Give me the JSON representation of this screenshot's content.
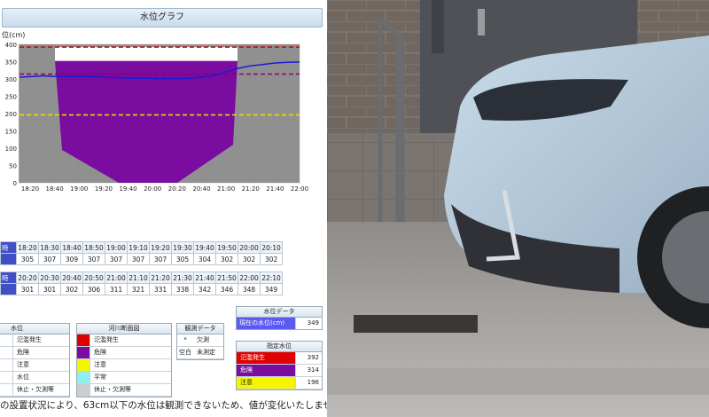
{
  "panel": {
    "title": "水位グラフ"
  },
  "chart_data": {
    "type": "area",
    "ylabel": "位(cm)",
    "ylim": [
      0,
      400
    ],
    "yticks": [
      "400",
      "350",
      "300",
      "250",
      "200",
      "150",
      "100",
      "50",
      "0"
    ],
    "xticks": [
      "18:20",
      "18:40",
      "19:00",
      "19:20",
      "19:40",
      "20:00",
      "20:20",
      "20:40",
      "21:00",
      "21:20",
      "21:40",
      "22:00"
    ],
    "lines": {
      "flood": 392,
      "danger": 314,
      "caution": 196
    },
    "water_level": [
      305,
      307,
      309,
      307,
      307,
      307,
      307,
      305,
      304,
      302,
      302,
      302,
      301,
      301,
      302,
      306,
      311,
      321,
      331,
      338,
      342,
      346,
      348,
      349
    ],
    "bank_profile_section": "river cross-section",
    "colors": {
      "ground": "#8a8a8a",
      "section": "#7a0ca0",
      "line": "#1a1ad8",
      "flood": "#e00000",
      "danger": "#8b0070",
      "caution": "#f0e000"
    }
  },
  "table1": {
    "head": "時",
    "times": [
      "18:20",
      "18:30",
      "18:40",
      "18:50",
      "19:00",
      "19:10",
      "19:20",
      "19:30",
      "19:40",
      "19:50",
      "20:00",
      "20:10"
    ],
    "values": [
      "305",
      "307",
      "309",
      "307",
      "307",
      "307",
      "307",
      "305",
      "304",
      "302",
      "302",
      "302"
    ]
  },
  "table2": {
    "head": "時",
    "times": [
      "20:20",
      "20:30",
      "20:40",
      "20:50",
      "21:00",
      "21:10",
      "21:20",
      "21:30",
      "21:40",
      "21:50",
      "22:00",
      "22:10"
    ],
    "values": [
      "301",
      "301",
      "302",
      "306",
      "311",
      "321",
      "331",
      "338",
      "342",
      "346",
      "348",
      "349"
    ]
  },
  "legend_level": {
    "title": "水位",
    "items": [
      {
        "label": "氾濫発生"
      },
      {
        "label": "危険"
      },
      {
        "label": "注意"
      },
      {
        "label": "水位"
      },
      {
        "label": "休止・欠測等"
      }
    ]
  },
  "legend_section": {
    "title": "河川断面図",
    "items": [
      {
        "label": "氾濫発生",
        "color": "#e00000"
      },
      {
        "label": "危険",
        "color": "#7a0ca0"
      },
      {
        "label": "注意",
        "color": "#f5f500"
      },
      {
        "label": "平常",
        "color": "#8ef0f0"
      },
      {
        "label": "休止・欠測等",
        "color": "#cccccc"
      }
    ]
  },
  "observation": {
    "title": "観測データ",
    "rows": [
      {
        "mark": "*",
        "text": "欠測"
      },
      {
        "mark": "空白",
        "text": "未測定"
      }
    ]
  },
  "current": {
    "title": "水位データ",
    "label": "現在の水位(cm)",
    "value": "349"
  },
  "designated": {
    "title": "指定水位",
    "rows": [
      {
        "label": "氾濫発生",
        "value": "392",
        "color": "#e00000"
      },
      {
        "label": "危険",
        "value": "314",
        "color": "#7a0ca0"
      },
      {
        "label": "注意",
        "value": "196",
        "color": "#f5f500"
      }
    ]
  },
  "footer": {
    "text": "の設置状況により、63cm以下の水位は観測できないため、値が変化いたしませ"
  }
}
